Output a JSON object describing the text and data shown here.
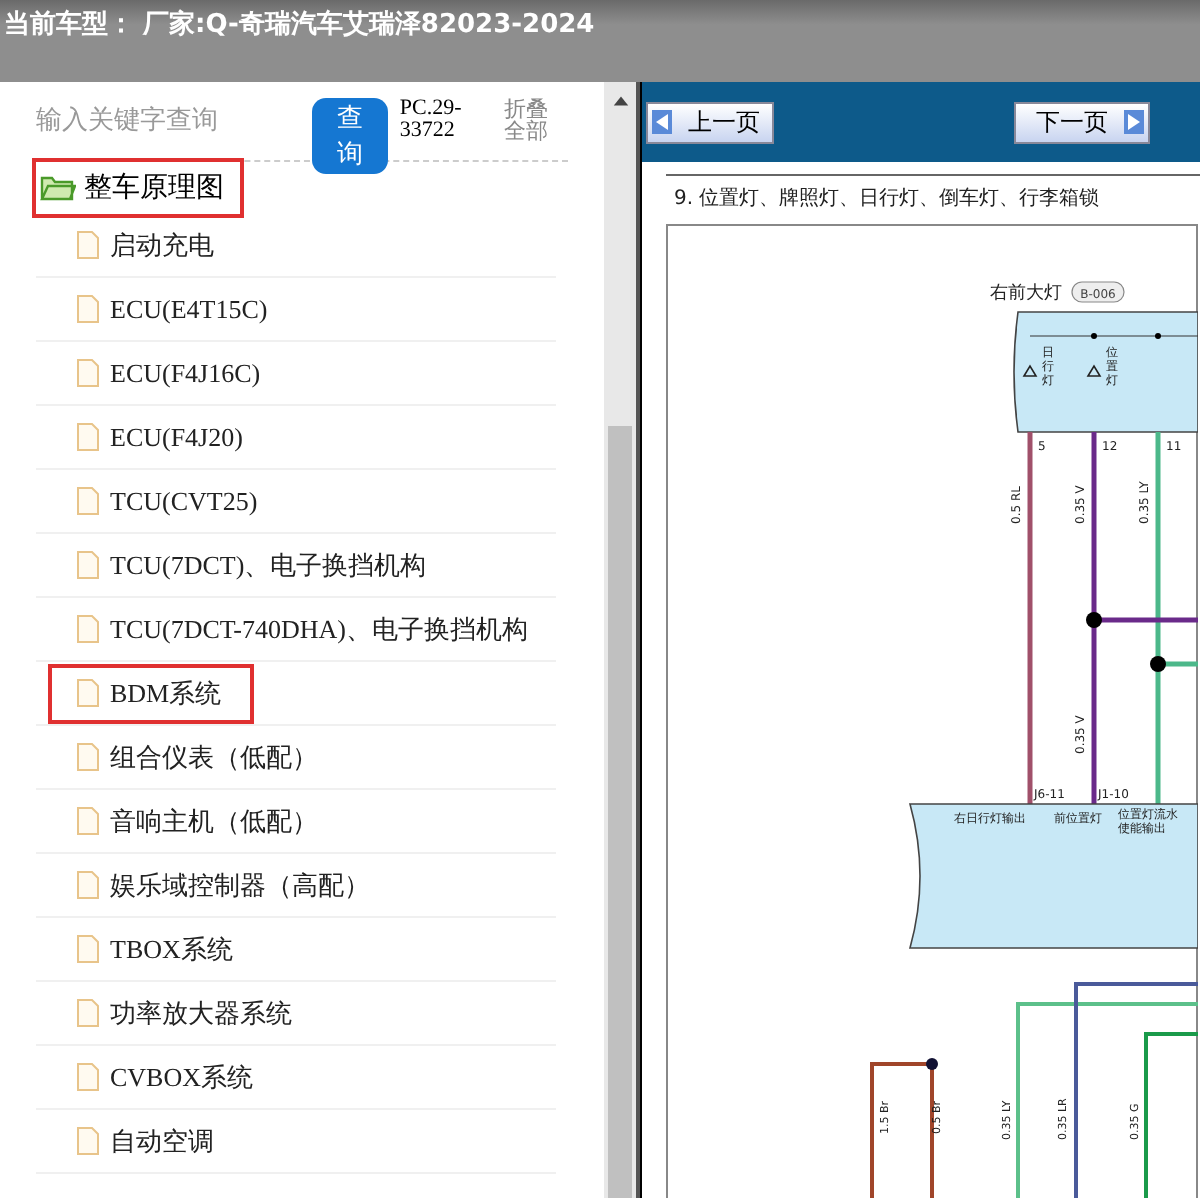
{
  "header": {
    "title": "当前车型： 厂家:Q-奇瑞汽车艾瑞泽82023-2024"
  },
  "search": {
    "placeholder": "输入关键字查询",
    "button": "查询",
    "code": "PC.29-33722",
    "collapse": "折叠全部"
  },
  "tree": [
    {
      "label": "整车原理图",
      "highlighted": true,
      "expanded": true,
      "children": [
        {
          "label": "启动充电",
          "highlighted": false
        },
        {
          "label": "ECU(E4T15C)",
          "highlighted": false
        },
        {
          "label": "ECU(F4J16C)",
          "highlighted": false
        },
        {
          "label": "ECU(F4J20)",
          "highlighted": false
        },
        {
          "label": "TCU(CVT25)",
          "highlighted": false
        },
        {
          "label": "TCU(7DCT)、电子换挡机构",
          "highlighted": false
        },
        {
          "label": "TCU(7DCT-740DHA)、电子换挡机构",
          "highlighted": false
        },
        {
          "label": "BDM系统",
          "highlighted": true
        },
        {
          "label": "组合仪表（低配）",
          "highlighted": false
        },
        {
          "label": "音响主机（低配）",
          "highlighted": false
        },
        {
          "label": "娱乐域控制器（高配）",
          "highlighted": false
        },
        {
          "label": "TBOX系统",
          "highlighted": false
        },
        {
          "label": "功率放大器系统",
          "highlighted": false
        },
        {
          "label": "CVBOX系统",
          "highlighted": false
        },
        {
          "label": "自动空调",
          "highlighted": false
        }
      ]
    }
  ],
  "viewer": {
    "prev": "上一页",
    "next": "下一页",
    "section_title": "9. 位置灯、牌照灯、日行灯、倒车灯、行李箱锁",
    "diagram": {
      "connector_title": "右前大灯",
      "connector_code": "B-006",
      "lamps": [
        {
          "label": "日行灯"
        },
        {
          "label": "位置灯"
        }
      ],
      "pins": [
        "5",
        "12",
        "11"
      ],
      "wires": [
        {
          "label": "0.5 RL"
        },
        {
          "label": "0.35 V"
        },
        {
          "label": "0.35 LY"
        }
      ],
      "lower_wire_label": "0.35 V",
      "terminals": [
        "J6-11",
        "J1-10"
      ],
      "outputs": [
        "右日行灯输出",
        "前位置灯",
        "位置灯流水使能输出"
      ],
      "bottom_wires": [
        {
          "label": "1.5 Br"
        },
        {
          "label": "0.5 Br"
        },
        {
          "label": "0.35 LY"
        },
        {
          "label": "0.35 LR"
        },
        {
          "label": "0.35 G"
        }
      ]
    }
  }
}
